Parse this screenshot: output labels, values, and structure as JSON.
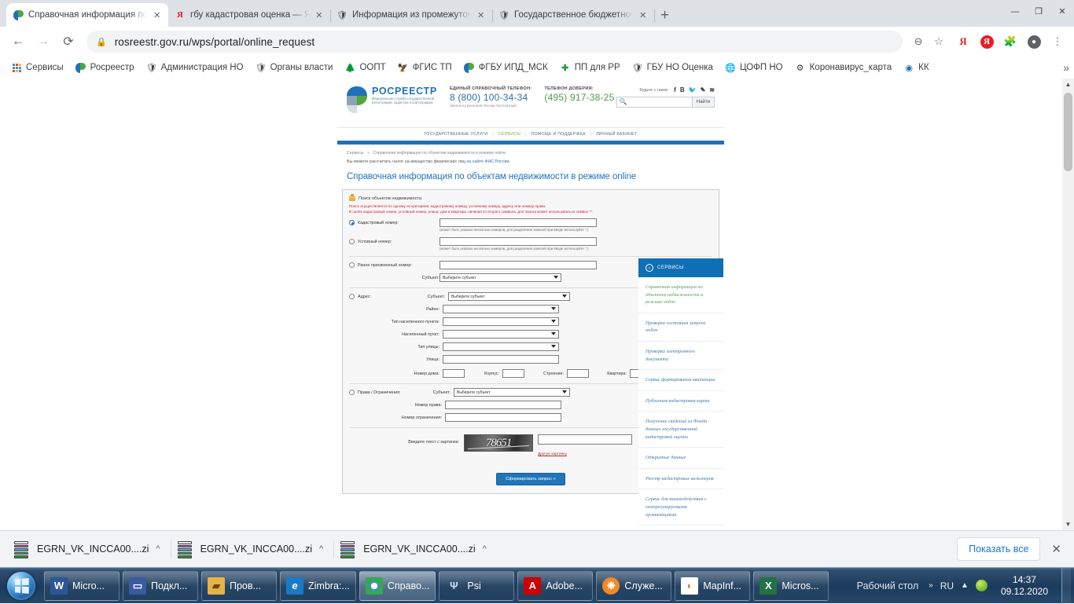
{
  "browser": {
    "tabs": [
      {
        "title": "Справочная информация по об",
        "favicon": "rosreestr-icon",
        "active": true
      },
      {
        "title": "гбу кадастровая оценка — Яндє",
        "favicon": "yandex-icon",
        "active": false
      },
      {
        "title": "Информация из промежуточнь",
        "favicon": "emblem-icon",
        "active": false
      },
      {
        "title": "Государственное бюджетное уч",
        "favicon": "emblem-icon",
        "active": false
      }
    ],
    "new_tab_label": "+",
    "window_controls": {
      "minimize": "—",
      "maximize": "❐",
      "close": "✕"
    },
    "nav": {
      "back": "←",
      "forward": "→",
      "reload": "⟳"
    },
    "omnibox": {
      "lock_icon": "lock-icon",
      "url": "rosreestr.gov.ru/wps/portal/online_request"
    },
    "omnibox_buttons": [
      "zoom-out-icon",
      "bookmark-star-icon"
    ],
    "toolbar_icons": [
      "yandex-translate-icon",
      "yandex-icon",
      "extensions-puzzle-icon",
      "profile-avatar-icon",
      "chrome-menu-icon"
    ],
    "bookmarks": [
      {
        "label": "Сервисы",
        "icon": "apps-grid-icon"
      },
      {
        "label": "Росреестр",
        "icon": "rosreestr-icon"
      },
      {
        "label": "Администрация НО",
        "icon": "emblem-icon"
      },
      {
        "label": "Органы власти",
        "icon": "emblem-icon"
      },
      {
        "label": "ООПТ",
        "icon": "tree-icon"
      },
      {
        "label": "ФГИС ТП",
        "icon": "eagle-icon"
      },
      {
        "label": "ФГБУ ИПД_МСК",
        "icon": "rosreestr-icon"
      },
      {
        "label": "ПП для РР",
        "icon": "green-cross-icon"
      },
      {
        "label": "ГБУ НО Оценка",
        "icon": "emblem-icon"
      },
      {
        "label": "ЦОФП НО",
        "icon": "globe-icon"
      },
      {
        "label": "Коронавирус_карта",
        "icon": "virus-icon"
      },
      {
        "label": "КК",
        "icon": "blue-circle-icon"
      }
    ],
    "bookmarks_overflow": "»"
  },
  "site": {
    "logo": {
      "name": "РОСРЕЕСТР",
      "subtitle": "Федеральная служба государственной регистрации, кадастра и картографии"
    },
    "phones": [
      {
        "caption": "ЕДИНЫЙ СПРАВОЧНЫЙ ТЕЛЕФОН:",
        "number": "8 (800) 100-34-34",
        "note": "Звонок из регионов России бесплатный",
        "style": "blue"
      },
      {
        "caption": "ТЕЛЕФОН ДОВЕРИЯ:",
        "number": "(495) 917-38-25",
        "note": "",
        "style": "green"
      }
    ],
    "social": {
      "label": "Будьте с нами:",
      "icons": [
        "facebook-icon",
        "vk-icon",
        "twitter-icon",
        "telegram-icon",
        "rss-icon"
      ]
    },
    "search": {
      "placeholder": "",
      "value": "",
      "button": "Найти",
      "icon": "search-icon"
    },
    "nav": [
      {
        "label": "ГОСУДАРСТВЕННЫЕ УСЛУГИ",
        "active": false
      },
      {
        "label": "СЕРВИСЫ",
        "active": true
      },
      {
        "label": "ПОМОЩЬ И ПОДДЕРЖКА",
        "active": false
      },
      {
        "label": "ЛИЧНЫЙ КАБИНЕТ",
        "active": false
      }
    ],
    "breadcrumb": {
      "root": "Сервисы",
      "separator": "»",
      "current": "Справочная информация по объектам недвижимости в режиме online"
    },
    "tax_note": {
      "text": "Вы можете рассчитать налог на имущество физических лиц ",
      "link": "на сайте ФНС России",
      "tail": "."
    },
    "page_title": "Справочная информация по объектам недвижимости в режиме online"
  },
  "form": {
    "legend": "Поиск объектов недвижимости",
    "warning_line1": "Поиск осуществляется по одному из критериев: кадастровому номеру, условному номеру, адресу или номеру права.",
    "warning_line2": "В полях кадастровый номер, условный номер, улица, дом и квартира, начиная со второго символа, для поиска может использоваться символ '*'.",
    "cadastral": {
      "label": "Кадастровый номер:",
      "selected": true,
      "value": "",
      "hint": "(может быть указано несколько номеров, для разделения записей при вводе используйте ';')"
    },
    "conditional": {
      "label": "Условный номер:",
      "selected": false,
      "value": "",
      "hint": "(может быть указано несколько номеров, для разделения записей при вводе используйте ';')"
    },
    "previous": {
      "label": "Ранее присвоенный номер:",
      "selected": false,
      "value": "",
      "subject_label": "Субъект:",
      "subject_value": "Выберите субъект"
    },
    "address": {
      "label": "Адрес:",
      "selected": false,
      "fields": [
        {
          "label": "Субъект:",
          "value": "Выберите субъект",
          "type": "select"
        },
        {
          "label": "Район:",
          "value": "",
          "type": "select"
        },
        {
          "label": "Тип населенного пункта:",
          "value": "",
          "type": "select"
        },
        {
          "label": "Населенный пункт:",
          "value": "",
          "type": "select"
        },
        {
          "label": "Тип улицы:",
          "value": "",
          "type": "select"
        },
        {
          "label": "Улица:",
          "value": "",
          "type": "text"
        }
      ],
      "house_row": [
        {
          "label": "Номер дома:",
          "value": ""
        },
        {
          "label": "Корпус:",
          "value": ""
        },
        {
          "label": "Строение:",
          "value": ""
        },
        {
          "label": "Квартира:",
          "value": ""
        }
      ]
    },
    "rights": {
      "label": "Права / Ограничения:",
      "selected": false,
      "subject_label": "Субъект:",
      "subject_value": "Выберите субъект",
      "right_number_label": "Номер права:",
      "right_number_value": "",
      "restriction_number_label": "Номер ограничения:",
      "restriction_number_value": ""
    },
    "captcha": {
      "label": "Введите текст с картинки:",
      "image_text": "78651",
      "input_value": "",
      "refresh_link": "Другую картинку"
    },
    "submit_label": "Сформировать запрос »"
  },
  "sidebar": {
    "title": "СЕРВИСЫ",
    "back_icon": "chevron-left-circle-icon",
    "items": [
      {
        "label": "Справочная информация по объектам недвижимости в режиме online",
        "active": true
      },
      {
        "label": "Проверка состояния запроса online",
        "active": false
      },
      {
        "label": "Проверка электронного документа",
        "active": false
      },
      {
        "label": "Сервис формирования квитанции",
        "active": false
      },
      {
        "label": "Публичная кадастровая карта",
        "active": false
      },
      {
        "label": "Получение сведений из Фонда данных государственной кадастровой оценки",
        "active": false
      },
      {
        "label": "Открытые данные",
        "active": false
      },
      {
        "label": "Реестр кадастровых инженеров",
        "active": false
      },
      {
        "label": "Сервис для взаимодействия с саморегулируемыми организациями",
        "active": false
      }
    ]
  },
  "downloads": {
    "items": [
      {
        "name": "EGRN_VK_INCCA00....zi",
        "icon": "archive-icon",
        "menu": "^"
      },
      {
        "name": "EGRN_VK_INCCA00....zi",
        "icon": "archive-icon",
        "menu": "^"
      },
      {
        "name": "EGRN_VK_INCCA00....zi",
        "icon": "archive-icon",
        "menu": "^"
      }
    ],
    "show_all": "Показать все",
    "close": "✕"
  },
  "taskbar": {
    "start_icon": "windows-start-orb",
    "buttons": [
      {
        "label": "Micro...",
        "icon": "word-icon",
        "color": "#2b579a",
        "glyph": "W",
        "active": false
      },
      {
        "label": "Подкл...",
        "icon": "remote-desktop-icon",
        "color": "#3a5ba0",
        "glyph": "🖥",
        "active": false
      },
      {
        "label": "Пров...",
        "icon": "folder-icon",
        "color": "#e8b24a",
        "glyph": "📁",
        "active": false
      },
      {
        "label": "Zimbra:...",
        "icon": "internet-explorer-icon",
        "color": "#1a79c4",
        "glyph": "e",
        "active": false
      },
      {
        "label": "Справо...",
        "icon": "chrome-icon",
        "color": "#34a853",
        "glyph": "◎",
        "active": true
      },
      {
        "label": "Psi",
        "icon": "psi-icon",
        "color": "#5b7fc7",
        "glyph": "Ψ",
        "active": false
      },
      {
        "label": "Adobe...",
        "icon": "acrobat-icon",
        "color": "#cc0000",
        "glyph": "A",
        "active": false
      },
      {
        "label": "Служе...",
        "icon": "orange-people-icon",
        "color": "#f08a24",
        "glyph": "👥",
        "active": false
      },
      {
        "label": "MapInf...",
        "icon": "mapinfo-icon",
        "color": "#d9822b",
        "glyph": "◐",
        "active": false
      },
      {
        "label": "Micros...",
        "icon": "excel-icon",
        "color": "#217346",
        "glyph": "X",
        "active": false
      }
    ],
    "desktop_label": "Рабочий стол",
    "overflow": "»",
    "language": "RU",
    "tray_chevron": "▲",
    "tray_icons": [
      "icq-flower-icon"
    ],
    "clock": {
      "time": "14:37",
      "date": "09.12.2020"
    }
  }
}
